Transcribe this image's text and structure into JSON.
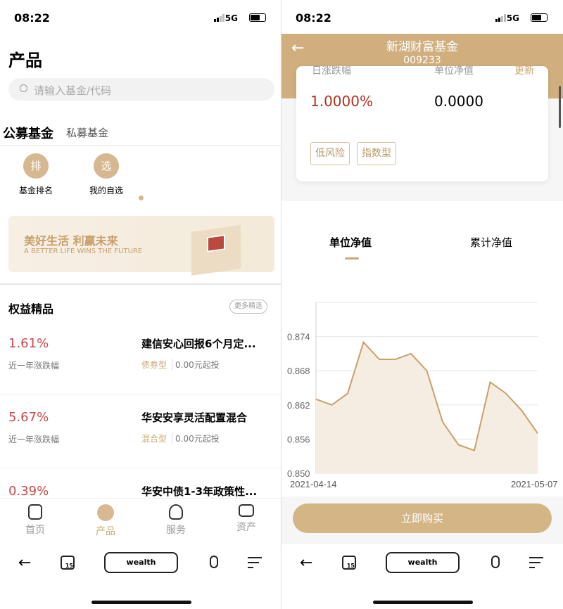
{
  "status": {
    "time": "08:22",
    "network": "5G"
  },
  "left": {
    "title": "产品",
    "search_placeholder": "请输入基金/代码",
    "tabs": [
      "公募基金",
      "私募基金"
    ],
    "quick": [
      {
        "icon": "排",
        "label": "基金排名"
      },
      {
        "icon": "选",
        "label": "我的自选"
      }
    ],
    "banner": {
      "title": "美好生活 利赢未来",
      "subtitle": "A BETTER LIFE WINS THE FUTURE"
    },
    "section_title": "权益精品",
    "more_label": "更多精选",
    "funds": [
      {
        "pct": "1.61%",
        "pct_label": "近一年涨跌幅",
        "name": "建信安心回报6个月定...",
        "type": "债券型",
        "min": "0.00元起投"
      },
      {
        "pct": "5.67%",
        "pct_label": "近一年涨跌幅",
        "name": "华安安享灵活配置混合",
        "type": "混合型",
        "min": "0.00元起投"
      },
      {
        "pct": "0.39%",
        "pct_label": "近一年涨跌幅",
        "name": "华安中债1-3年政策性...",
        "type": "",
        "min": ""
      }
    ],
    "tabbar": [
      {
        "label": "首页",
        "active": false
      },
      {
        "label": "产品",
        "active": true
      },
      {
        "label": "服务",
        "active": false
      },
      {
        "label": "资产",
        "active": false
      }
    ]
  },
  "browser": {
    "tabs_count": "15",
    "url": "wealth"
  },
  "right": {
    "fund_name": "新湖财富基金",
    "fund_code": "009233",
    "daily_change_label": "日涨跌幅",
    "nav_label": "单位净值",
    "update_label": "更新",
    "daily_change": "1.0000%",
    "nav": "0.0000",
    "tags": [
      "低风险",
      "指数型"
    ],
    "chart_tabs": [
      "单位净值",
      "累计净值"
    ],
    "buy_label": "立即购买"
  },
  "colors": {
    "accent": "#c9a873",
    "header": "#d0ae7e",
    "up": "#cc4a4a"
  },
  "chart_data": {
    "type": "area",
    "x_start": "2021-04-14",
    "x_end": "2021-05-07",
    "xtick_labels": [
      "2021-04-14",
      "2021-05-07"
    ],
    "values": [
      0.863,
      0.862,
      0.864,
      0.873,
      0.87,
      0.87,
      0.871,
      0.868,
      0.859,
      0.855,
      0.854,
      0.866,
      0.864,
      0.861,
      0.857
    ],
    "yticks": [
      "0.850",
      "0.856",
      "0.862",
      "0.868",
      "0.874"
    ],
    "ylim": [
      0.85,
      0.88
    ],
    "grid": true,
    "line_color": "#c9a06a",
    "fill_color": "#f5ece2"
  }
}
